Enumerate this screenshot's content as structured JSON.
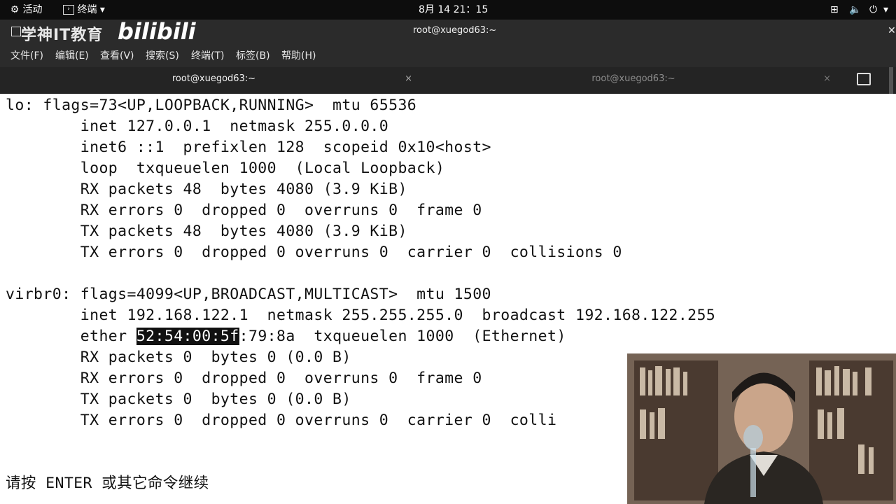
{
  "topbar": {
    "activities": "活动",
    "app_name": "终端",
    "clock": "8月 14  21：15"
  },
  "window": {
    "logo_text": "学神IT教育",
    "brand_text": "bilibili",
    "title": "root@xuegod63:~"
  },
  "menubar": {
    "file": "文件(F)",
    "edit": "编辑(E)",
    "view": "查看(V)",
    "search": "搜索(S)",
    "terminal": "终端(T)",
    "tabs": "标签(B)",
    "help": "帮助(H)"
  },
  "tabs": [
    {
      "label": "root@xuegod63:~",
      "active": true
    },
    {
      "label": "root@xuegod63:~",
      "active": false
    }
  ],
  "terminal": {
    "lines": [
      "lo: flags=73<UP,LOOPBACK,RUNNING>  mtu 65536",
      "        inet 127.0.0.1  netmask 255.0.0.0",
      "        inet6 ::1  prefixlen 128  scopeid 0x10<host>",
      "        loop  txqueuelen 1000  (Local Loopback)",
      "        RX packets 48  bytes 4080 (3.9 KiB)",
      "        RX errors 0  dropped 0  overruns 0  frame 0",
      "        TX packets 48  bytes 4080 (3.9 KiB)",
      "        TX errors 0  dropped 0 overruns 0  carrier 0  collisions 0",
      "",
      "virbr0: flags=4099<UP,BROADCAST,MULTICAST>  mtu 1500",
      "        inet 192.168.122.1  netmask 255.255.255.0  broadcast 192.168.122.255",
      "",
      "        RX packets 0  bytes 0 (0.0 B)",
      "        RX errors 0  dropped 0  overruns 0  frame 0",
      "        TX packets 0  bytes 0 (0.0 B)",
      "        TX errors 0  dropped 0 overruns 0  carrier 0  colli",
      "",
      "请按 ENTER 或其它命令继续"
    ],
    "ether_line": {
      "before": "        ether ",
      "selected": "52:54:00:5f",
      "after": ":79:8a  txqueuelen 1000  (Ethernet)"
    }
  },
  "colors": {
    "topbar_bg": "#0d0d0d",
    "window_bg": "#2b2b2b",
    "terminal_bg": "#ffffff",
    "terminal_fg": "#111111"
  }
}
